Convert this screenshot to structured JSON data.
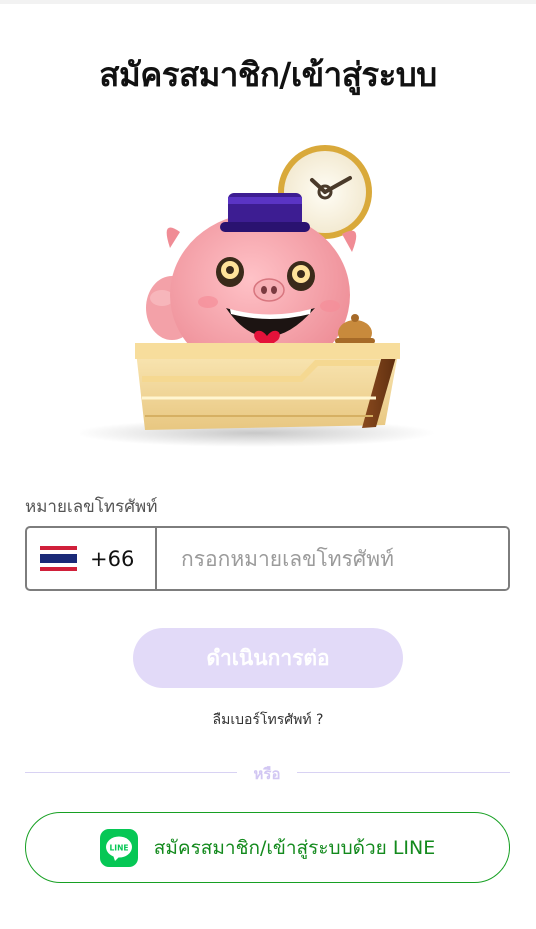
{
  "page": {
    "title": "สมัครสมาชิก/เข้าสู่ระบบ"
  },
  "phone": {
    "label": "หมายเลขโทรศัพท์",
    "country_code": "+66",
    "flag_icon": "thailand-flag-icon",
    "placeholder": "กรอกหมายเลขโทรศัพท์",
    "value": ""
  },
  "actions": {
    "continue_label": "ดำเนินการต่อ",
    "forgot_label": "ลืมเบอร์โทรศัพท์ ?",
    "divider_label": "หรือ",
    "line_label": "สมัครสมาชิก/เข้าสู่ระบบด้วย LINE",
    "line_icon_text": "LINE"
  },
  "colors": {
    "continue_bg": "#e2daf8",
    "line_green": "#06c755",
    "line_border": "#17a023",
    "divider": "#d8d2f3"
  }
}
